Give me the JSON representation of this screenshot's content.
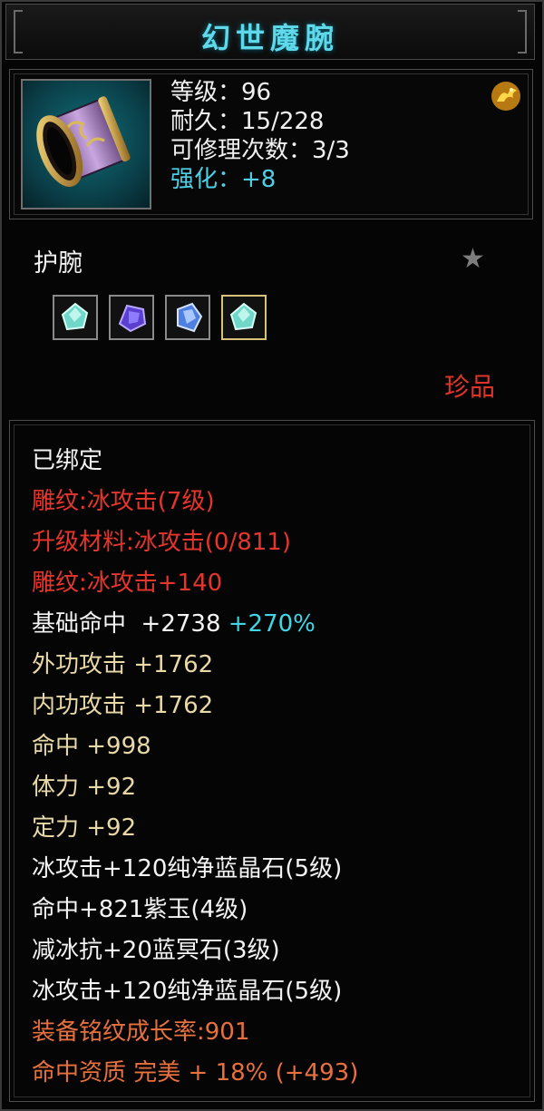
{
  "item": {
    "name": "幻世魔腕",
    "icon": "bracer-icon",
    "stats": [
      {
        "text": "等级：96"
      },
      {
        "text": "耐久：15/228"
      },
      {
        "text": "可修理次数：3/3"
      },
      {
        "text": "强化：+8"
      }
    ],
    "badge_icon": "gold-dragon-icon",
    "type": "护腕",
    "favorite_icon": "star-icon",
    "gems": [
      {
        "name": "green-gem-icon"
      },
      {
        "name": "purple-gem-icon"
      },
      {
        "name": "blue-gem-icon"
      },
      {
        "name": "green-gem-icon"
      }
    ],
    "rarity": "珍品"
  },
  "colors": {
    "title": "#5fd9ea",
    "white": "#f4f4f4",
    "red": "#e5352c",
    "gold": "#e9d9a6",
    "cyan": "#40d6e6",
    "orange": "#e7713e"
  },
  "attributes": [
    {
      "text": "已绑定",
      "color": "white"
    },
    {
      "text": "雕纹:冰攻击(7级)",
      "color": "red"
    },
    {
      "text": "升级材料:冰攻击(0/811)",
      "color": "red"
    },
    {
      "text": "雕纹:冰攻击+140",
      "color": "red"
    },
    {
      "label": "基础命中",
      "value": "+2738",
      "extra": "+270%",
      "color": "white"
    },
    {
      "text": "外功攻击  +1762",
      "color": "gold"
    },
    {
      "text": "内功攻击  +1762",
      "color": "gold"
    },
    {
      "text": "命中  +998",
      "color": "gold"
    },
    {
      "text": "体力  +92",
      "color": "gold"
    },
    {
      "text": "定力  +92",
      "color": "gold"
    },
    {
      "text": "冰攻击+120纯净蓝晶石(5级)",
      "color": "white"
    },
    {
      "text": "命中+821紫玉(4级)",
      "color": "white"
    },
    {
      "text": "减冰抗+20蓝冥石(3级)",
      "color": "white"
    },
    {
      "text": "冰攻击+120纯净蓝晶石(5级)",
      "color": "white"
    },
    {
      "text": "装备铭纹成长率:901",
      "color": "orange"
    },
    {
      "text": "命中资质  完美  + 18% (+493)",
      "color": "orange"
    }
  ]
}
